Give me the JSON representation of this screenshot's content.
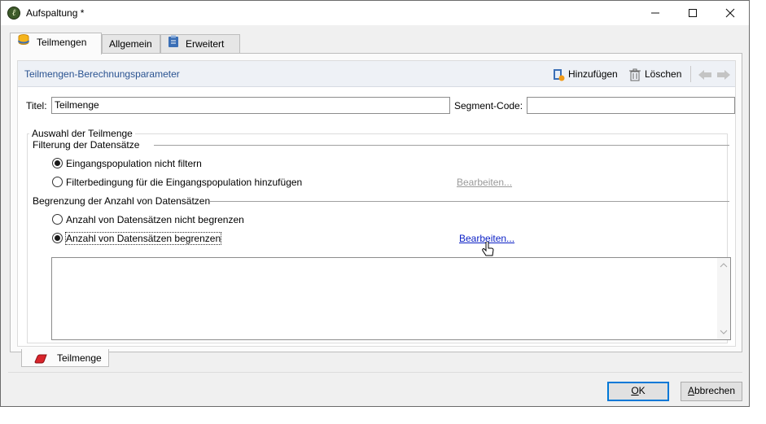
{
  "window": {
    "title": "Aufspaltung *",
    "icon": "app-leaf-icon",
    "controls": [
      "minimize",
      "maximize",
      "close"
    ]
  },
  "tabs": [
    {
      "label": "Teilmengen",
      "icon": "database-icon",
      "active": true
    },
    {
      "label": "Allgemein",
      "active": false
    },
    {
      "label": "Erweitert",
      "icon": "clipboard-icon",
      "active": false
    }
  ],
  "section": {
    "title": "Teilmengen-Berechnungsparameter",
    "add_label": "Hinzufügen",
    "delete_label": "Löschen"
  },
  "form": {
    "title_label": "Titel:",
    "title_value": "Teilmenge",
    "segment_label": "Segment-Code:",
    "segment_value": ""
  },
  "group": {
    "legend": "Auswahl der Teilmenge",
    "filter_heading": "Filterung der Datensätze",
    "filter_options": [
      {
        "label": "Eingangspopulation nicht filtern",
        "checked": true
      },
      {
        "label": "Filterbedingung für die Eingangspopulation hinzufügen",
        "checked": false
      }
    ],
    "filter_edit_link": "Bearbeiten...",
    "limit_heading": "Begrenzung der Anzahl von Datensätzen",
    "limit_options": [
      {
        "label": "Anzahl von Datensätzen nicht begrenzen",
        "checked": false
      },
      {
        "label": "Anzahl von Datensätzen begrenzen",
        "checked": true
      }
    ],
    "limit_edit_link": "Bearbeiten..."
  },
  "bottom_tab": {
    "label": "Teilmenge",
    "icon": "subset-shape-icon"
  },
  "buttons": {
    "ok_prefix": "",
    "ok_hotkey": "O",
    "ok_rest": "K",
    "cancel_hotkey": "A",
    "cancel_rest": "bbrechen"
  },
  "colors": {
    "section_title": "#2a5391",
    "active_link": "#0a1fc5",
    "default_button_border": "#0078d7"
  }
}
